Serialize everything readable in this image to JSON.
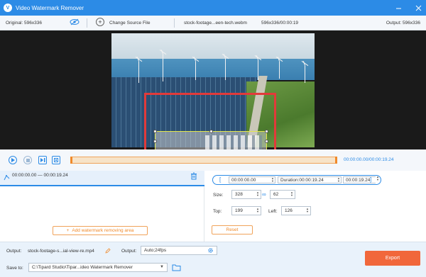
{
  "titlebar": {
    "logo": "V",
    "title": "Video Watermark Remover"
  },
  "infobar": {
    "original": "Original: 596x336",
    "change_source": "Change Source File",
    "filename": "stock-footage...een-tech.webm",
    "resolution_duration": "596x336/00:00:19",
    "output": "Output: 596x336"
  },
  "playback": {
    "time": "00:00:00.00/00:00:19.24"
  },
  "segment": {
    "range": "00:00:00.00 — 00:00:19.24"
  },
  "add_area_label": "Add watermark removing area",
  "time_range": {
    "start": "00:00:00.00",
    "duration": "Duration:00:00:19.24",
    "end": "00:00:19.24"
  },
  "size": {
    "label": "Size:",
    "width": "328",
    "height": "62"
  },
  "position": {
    "top_label": "Top:",
    "top": "199",
    "left_label": "Left:",
    "left": "126"
  },
  "reset_label": "Reset",
  "bottom": {
    "output_label": "Output:",
    "output_file": "stock-footage-s...ial-view-re.mp4",
    "format_label": "Output:",
    "format": "Auto;24fps",
    "save_label": "Save to:",
    "save_path": "C:\\Tipard Studio\\Tipar...ideo Watermark Remover",
    "export": "Export"
  },
  "colors": {
    "accent": "#2c8be6",
    "orange": "#f08a2b",
    "export": "#f1673b",
    "watermark_box": "#e23a3a"
  }
}
